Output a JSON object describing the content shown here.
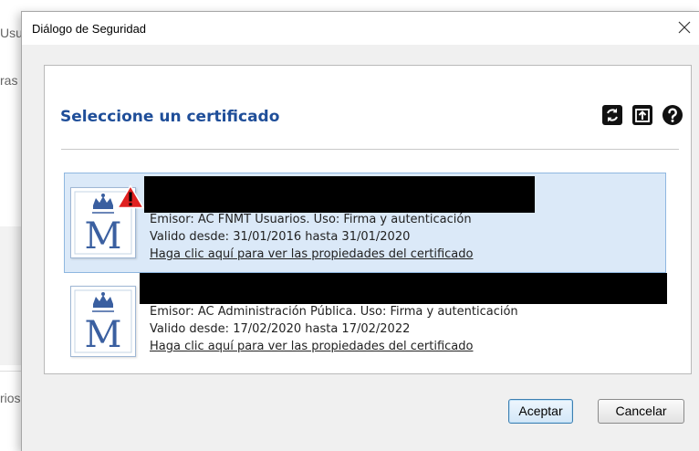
{
  "background": {
    "fragments": [
      "Usu",
      "ras",
      "rios"
    ]
  },
  "dialog": {
    "title": "Diálogo de Seguridad",
    "close_label": "×",
    "heading": "Seleccione un certificado",
    "toolbar": {
      "icons": [
        "refresh-icon",
        "import-icon",
        "help-icon"
      ]
    },
    "certificates": [
      {
        "issuer": "Emisor: AC FNMT Usuarios. Uso: Firma y autenticación",
        "validity": "Valido desde: 31/01/2016 hasta 31/01/2020",
        "link": "Haga clic aquí para ver las propiedades del certificado",
        "selected": true,
        "warning": true
      },
      {
        "issuer": "Emisor: AC Administración Pública. Uso: Firma y autenticación",
        "validity": "Valido desde: 17/02/2020 hasta 17/02/2022",
        "link": "Haga clic aquí para ver las propiedades del certificado",
        "selected": false,
        "warning": false
      }
    ],
    "buttons": {
      "accept": "Aceptar",
      "cancel": "Cancelar"
    }
  },
  "colors": {
    "heading": "#1f4e99",
    "selected_bg": "#dbe9f8",
    "warning": "#e02020"
  }
}
